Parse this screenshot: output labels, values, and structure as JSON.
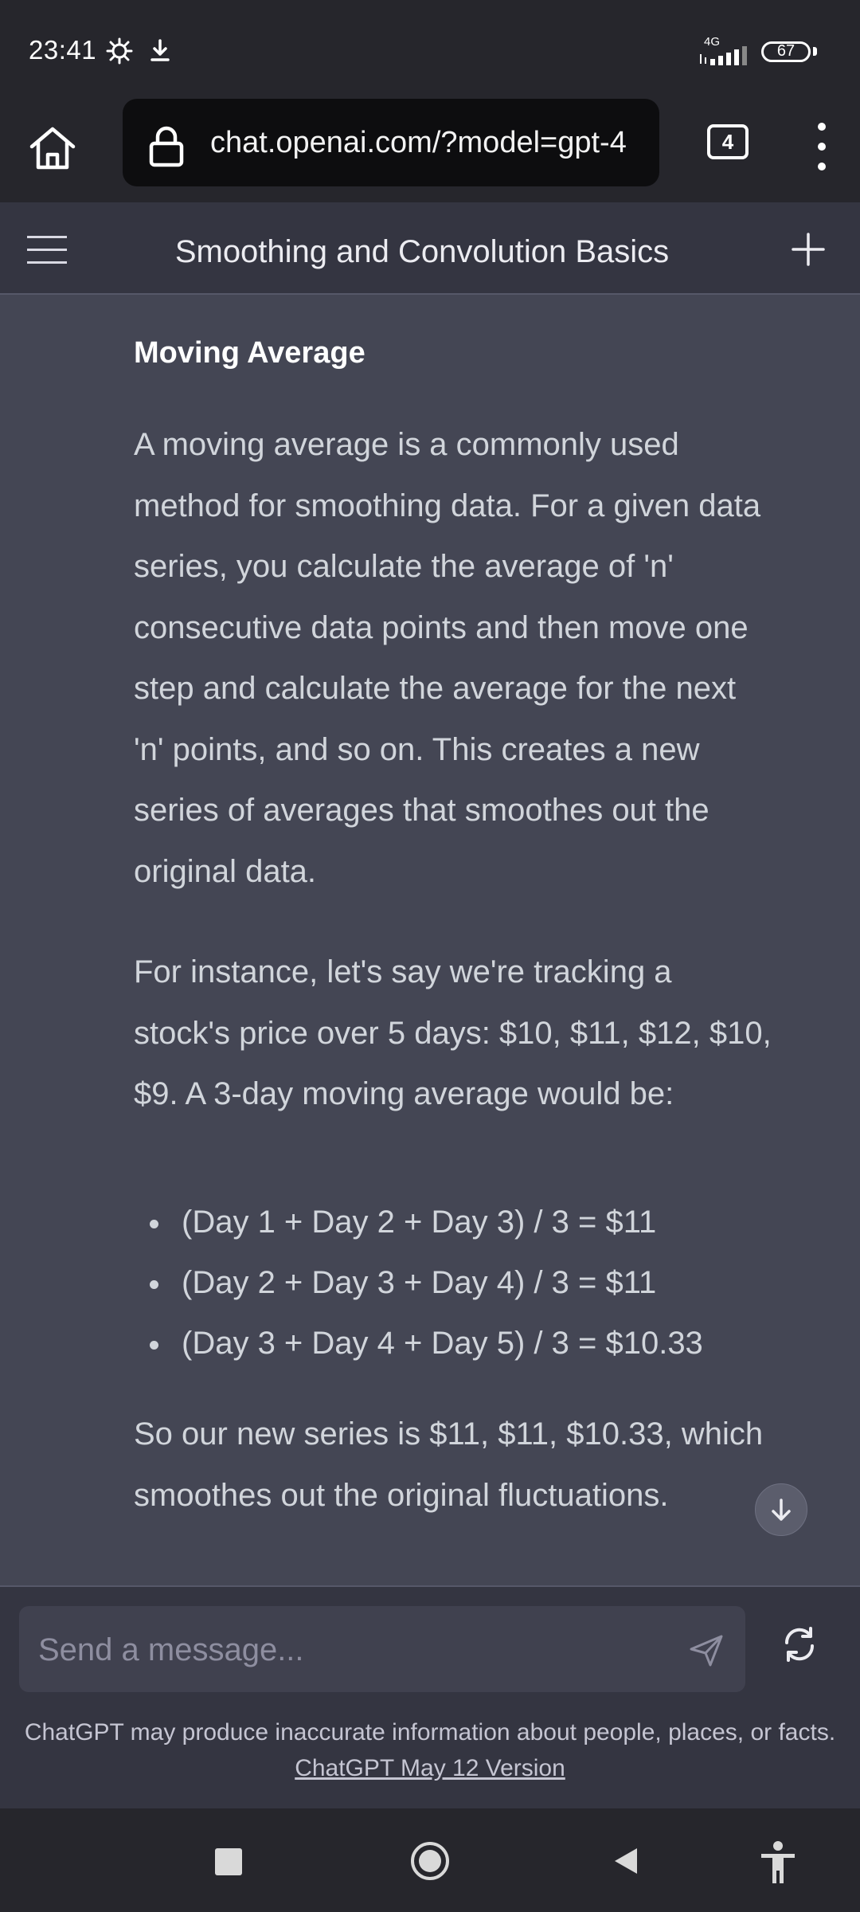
{
  "status_bar": {
    "time": "23:41",
    "network": "4G",
    "battery": "67",
    "icons": [
      "settings-gear-icon",
      "download-icon",
      "signal-icon",
      "battery-icon"
    ]
  },
  "browser": {
    "url": "chat.openai.com/?model=gpt-4",
    "tab_count": "4",
    "icons": [
      "home-icon",
      "lock-icon",
      "more-vert-icon"
    ]
  },
  "header": {
    "title": "Smoothing and Convolution Basics",
    "icons": [
      "hamburger-menu-icon",
      "plus-icon"
    ]
  },
  "message": {
    "heading": "Moving Average",
    "paragraph1": [
      "A moving average is a commonly used",
      "method for smoothing data. For a given data",
      "series, you calculate the average of 'n'",
      "consecutive data points and then move one",
      "step and calculate the average for the next",
      "'n' points, and so on. This creates a new",
      "series of averages that smoothes out the",
      "original data."
    ],
    "paragraph2": [
      "For instance, let's say we're tracking a",
      "stock's price over 5 days: $10, $11, $12, $10,",
      "$9. A 3-day moving average would be:"
    ],
    "bullets": [
      "(Day 1 + Day 2 + Day 3) / 3 = $11",
      "(Day 2 + Day 3 + Day 4) / 3 = $11",
      "(Day 3 + Day 4 + Day 5) / 3 = $10.33"
    ],
    "paragraph3": [
      "So our new series is $11, $11, $10.33, which",
      "smoothes out the original fluctuations."
    ]
  },
  "composer": {
    "placeholder": "Send a message...",
    "icons": [
      "send-icon",
      "regenerate-icon",
      "scroll-down-icon"
    ],
    "disclaimer_text": "ChatGPT may produce inaccurate information about people, places, or facts.",
    "version_link": "ChatGPT May 12 Version"
  },
  "nav_bar": {
    "icons": [
      "recents-square-icon",
      "home-circle-icon",
      "back-triangle-icon",
      "accessibility-icon"
    ]
  },
  "colors": {
    "system_bar": "#26262c",
    "header_bg": "#343541",
    "message_bg": "#444654",
    "input_bg": "#40414f",
    "text_primary": "#d1d5db"
  }
}
